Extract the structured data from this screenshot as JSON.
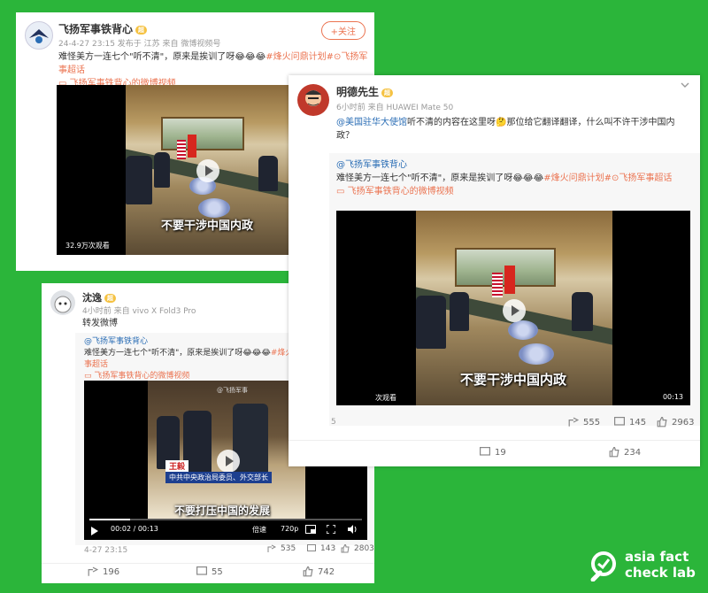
{
  "post1": {
    "author": "飞扬军事铁背心",
    "level": "超",
    "meta": "24-4-27 23:15  发布于 江苏  来自 微博视频号",
    "follow_label": "+关注",
    "text_a": "难怪美方一连七个\"听不清\"，原来是挨训了呀😂😂😂",
    "hashtag1": "#烽火问鼎计划#",
    "hashtag2": "飞扬军事超话",
    "video_link": "飞扬军事铁背心的微博视频",
    "subtitle": "不要干涉中国内政",
    "views": "32.9万次观看"
  },
  "post2": {
    "author": "明德先生",
    "level": "超",
    "meta": "6小时前  来自 HUAWEI Mate 50",
    "mention": "@美国驻华大使馆",
    "text": "听不清的内容在这里呀🤔那位给它翻译翻译，什么叫不许干涉中国内政？",
    "repost_author": "@飞扬军事铁背心",
    "repost_text": "难怪美方一连七个\"听不清\"，原来是挨训了呀😂😂😂",
    "hashtag1": "#烽火问鼎计划#",
    "hashtag2": "飞扬军事超话",
    "video_link": "飞扬军事铁背心的微博视频",
    "subtitle": "不要干涉中国内政",
    "views_tail": "次观看",
    "duration": "00:13",
    "repost_stats": {
      "forward": "555",
      "comment": "145",
      "like": "2963"
    },
    "footer_left_tail": "5",
    "comments": "19",
    "likes": "234"
  },
  "post3": {
    "author": "沈逸",
    "level": "超",
    "meta": "4小时前  来自 vivo X Fold3 Pro",
    "text": "转发微博",
    "repost_author": "@飞扬军事铁背心",
    "repost_text": "难怪美方一连七个\"听不清\"，原来是挨训了呀😂😂😂",
    "hashtag1": "#烽火问鼎计划#",
    "hashtag2": "飞扬军事超话",
    "video_link": "飞扬军事铁背心的微博视频",
    "watermark": "@飞扬军事",
    "name_caption": "王毅",
    "title_caption": "中共中央政治局委员、外交部长",
    "subtitle": "不要打压中国的发展",
    "time_current": "00:02",
    "time_total": "00:13",
    "speed": "倍速",
    "quality": "720p",
    "progress": 0.15,
    "date": "4-27 23:15",
    "repost_stats": {
      "forward": "535",
      "comment": "143",
      "like": "2803"
    },
    "forward": "196",
    "comments": "55",
    "likes": "742"
  },
  "brand": {
    "line1": "asia fact",
    "line2": "check lab"
  },
  "colors": {
    "background": "#2bb53a",
    "link": "#eb7350",
    "mention": "#2a6db5"
  }
}
